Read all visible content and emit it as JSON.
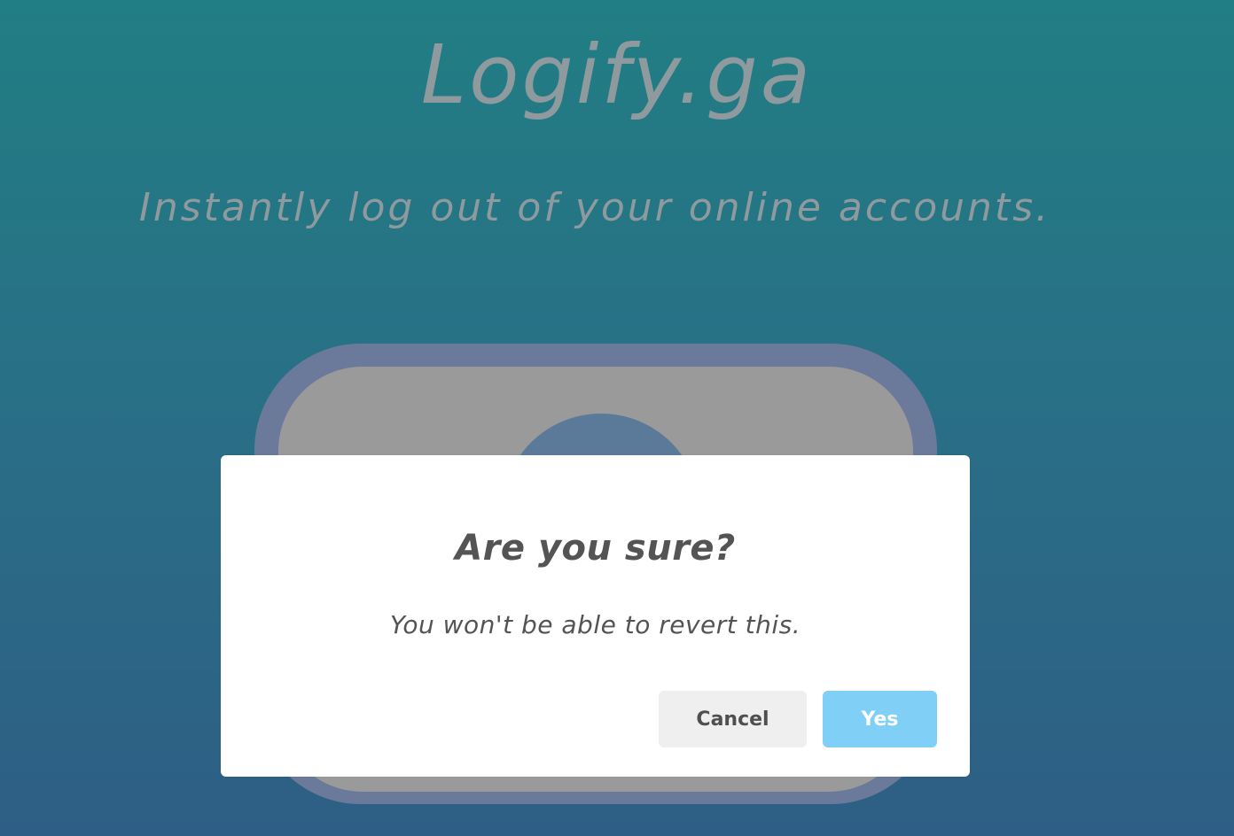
{
  "page": {
    "title": "Logify.ga",
    "tagline": "Instantly log out of your online accounts."
  },
  "dialog": {
    "title": "Are you sure?",
    "message": "You won't be able to revert this.",
    "cancel_label": "Cancel",
    "confirm_label": "Yes"
  },
  "colors": {
    "background_top": "#217e84",
    "background_bottom": "#2e5e85",
    "heading_text": "#8e9a9e",
    "confirm_button": "#7fcff6",
    "cancel_button": "#efefef"
  }
}
